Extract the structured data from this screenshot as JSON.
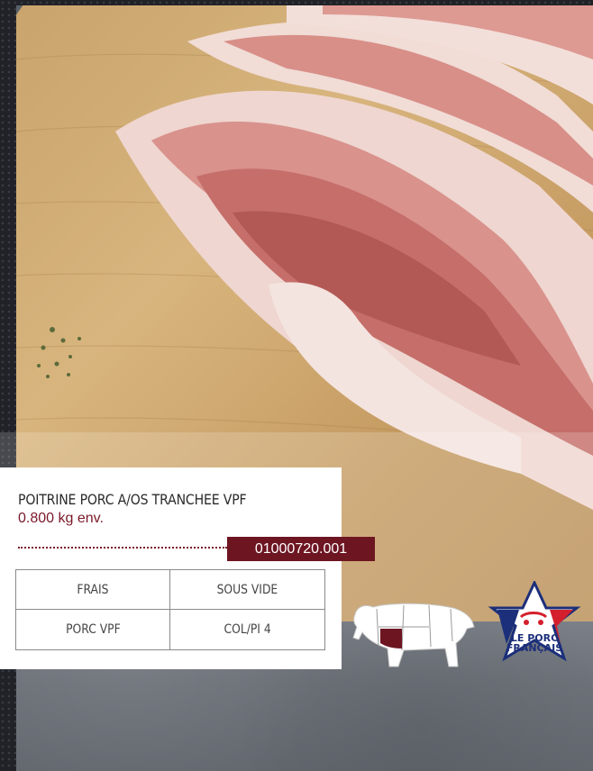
{
  "product": {
    "name": "POITRINE PORC A/OS TRANCHEE VPF",
    "weight": "0.800 kg env.",
    "code": "01000720.001"
  },
  "attributes": [
    [
      "FRAIS",
      "SOUS VIDE"
    ],
    [
      "PORC VPF",
      "COL/PI 4"
    ]
  ],
  "badge": {
    "line1": "LE PORC",
    "line2": "FRANÇAIS"
  },
  "icons": {
    "pig": "pig-cut-diagram-icon",
    "label": "le-porc-francais-label"
  },
  "colors": {
    "accent": "#6e1522",
    "weight_text": "#7a1828",
    "badge_blue": "#1c2f7a",
    "badge_red": "#d4202c"
  }
}
